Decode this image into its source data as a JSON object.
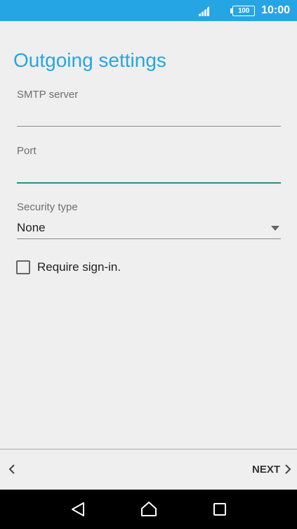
{
  "status_bar": {
    "battery_level": "100",
    "time": "10:00",
    "background_color": "#26a5e4"
  },
  "page": {
    "title": "Outgoing settings",
    "title_color": "#26a5e4"
  },
  "fields": {
    "smtp": {
      "label": "SMTP server",
      "value": ""
    },
    "port": {
      "label": "Port",
      "value": ""
    },
    "security": {
      "label": "Security type",
      "value": "None"
    }
  },
  "require_signin": {
    "label": "Require sign-in.",
    "checked": false
  },
  "footer": {
    "back_icon": "chevron-left-icon",
    "next_label": "NEXT",
    "next_icon": "chevron-right-icon"
  },
  "nav_bar": {
    "back_icon": "triangle-back-icon",
    "home_icon": "home-icon",
    "recents_icon": "square-recents-icon"
  },
  "accent_focus_color": "#2e8d80"
}
